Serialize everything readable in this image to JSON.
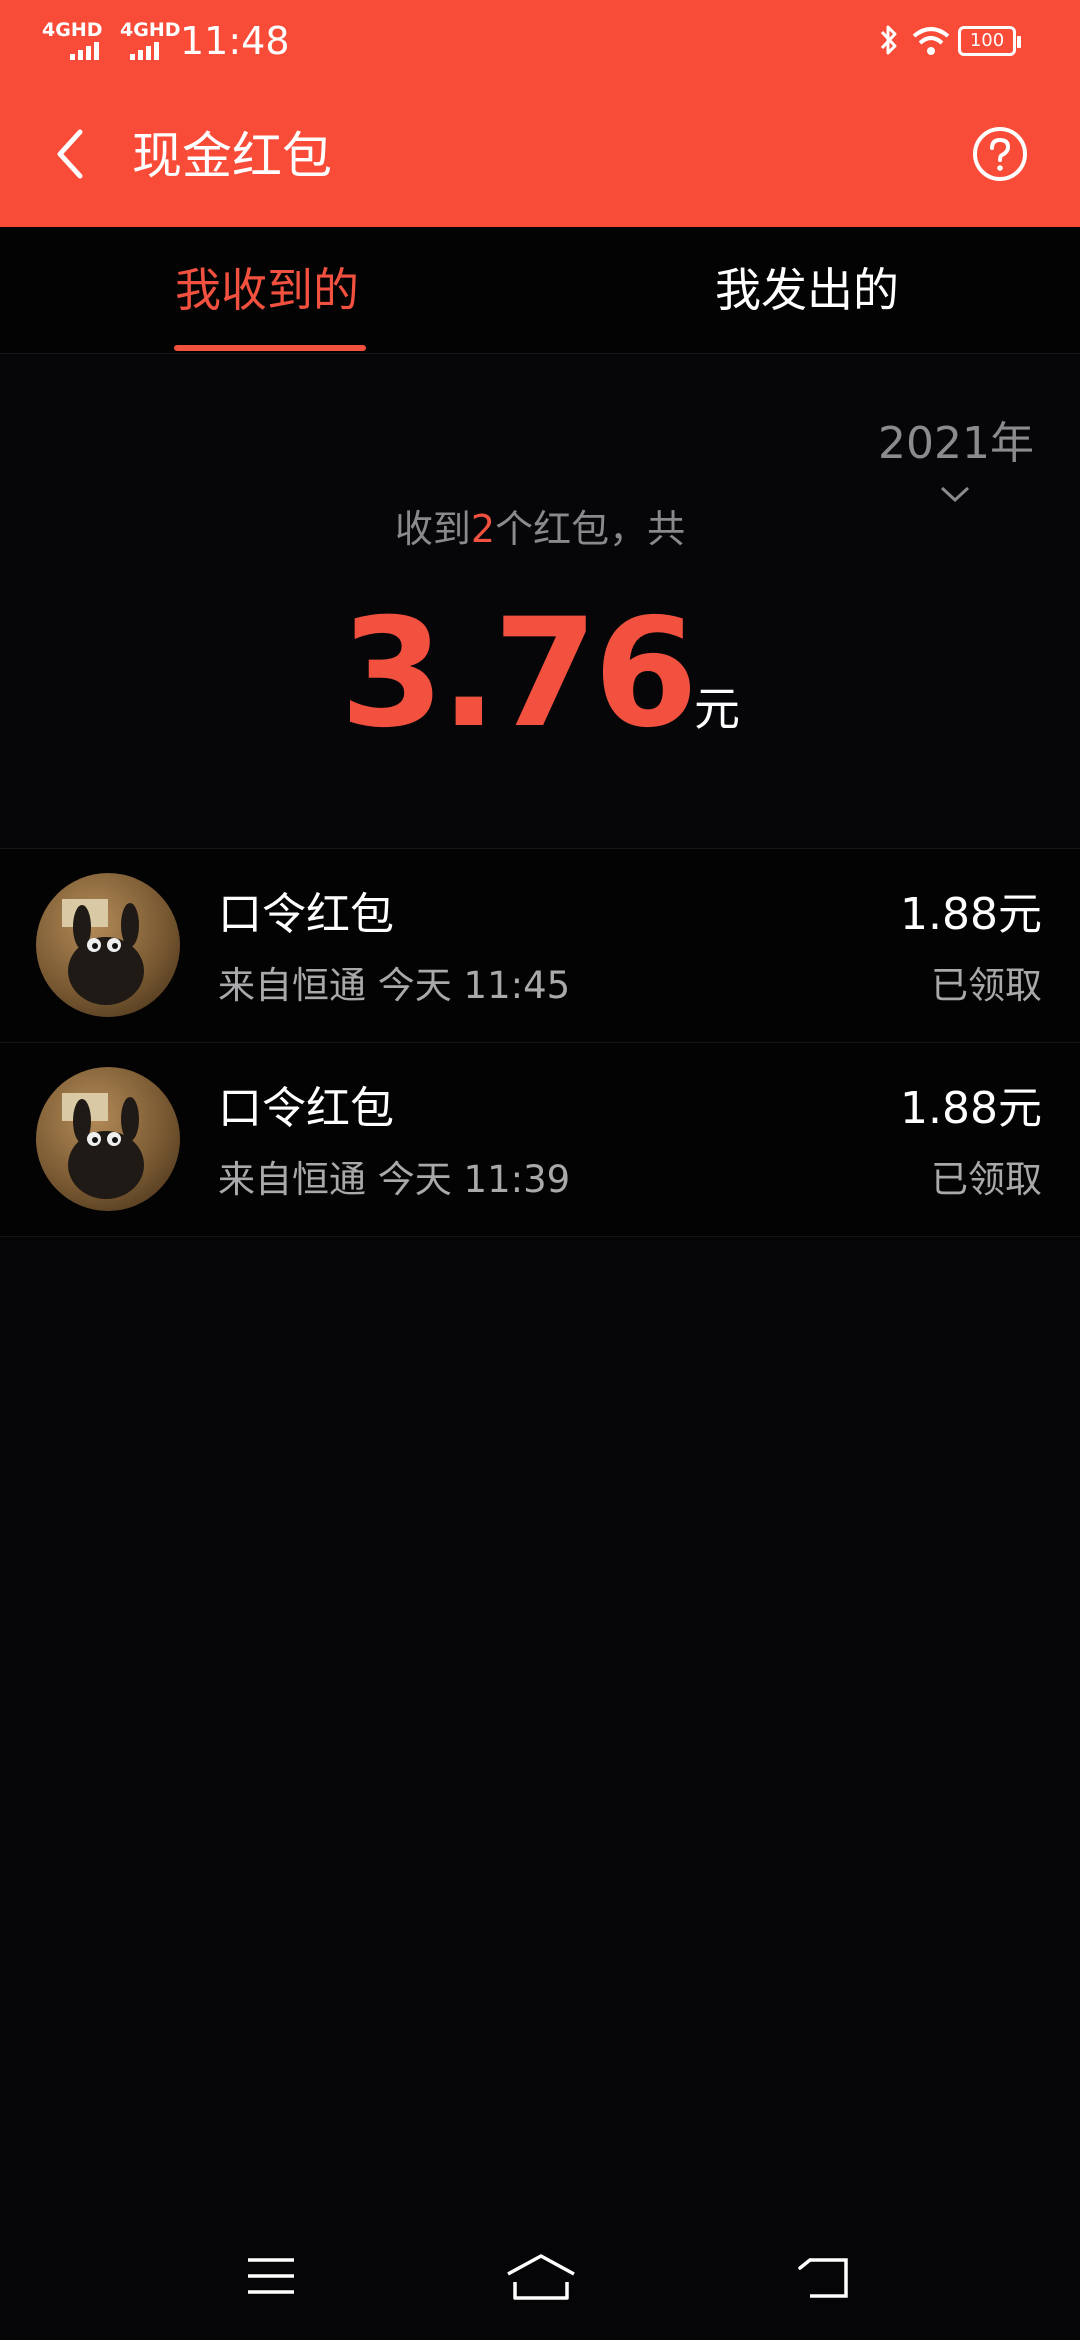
{
  "status_bar": {
    "signal_1": "4GHD",
    "signal_2": "4GHD",
    "time": "11:48",
    "battery": "100",
    "icons": [
      "signal-icon",
      "signal-icon",
      "bluetooth-icon",
      "wifi-icon",
      "battery-icon"
    ]
  },
  "header": {
    "title": "现金红包",
    "background": "#f84c39"
  },
  "tabs": [
    {
      "label": "我收到的",
      "active": true
    },
    {
      "label": "我发出的",
      "active": false
    }
  ],
  "summary": {
    "year": "2021年",
    "prefix": "收到",
    "count": "2",
    "suffix": "个红包，共",
    "total": "3.76",
    "unit": "元"
  },
  "list": [
    {
      "title": "口令红包",
      "subtitle": "来自恒通 今天 11:45",
      "amount": "1.88元",
      "status": "已领取"
    },
    {
      "title": "口令红包",
      "subtitle": "来自恒通 今天 11:39",
      "amount": "1.88元",
      "status": "已领取"
    }
  ],
  "colors": {
    "accent": "#f1513e",
    "background": "#050507"
  }
}
